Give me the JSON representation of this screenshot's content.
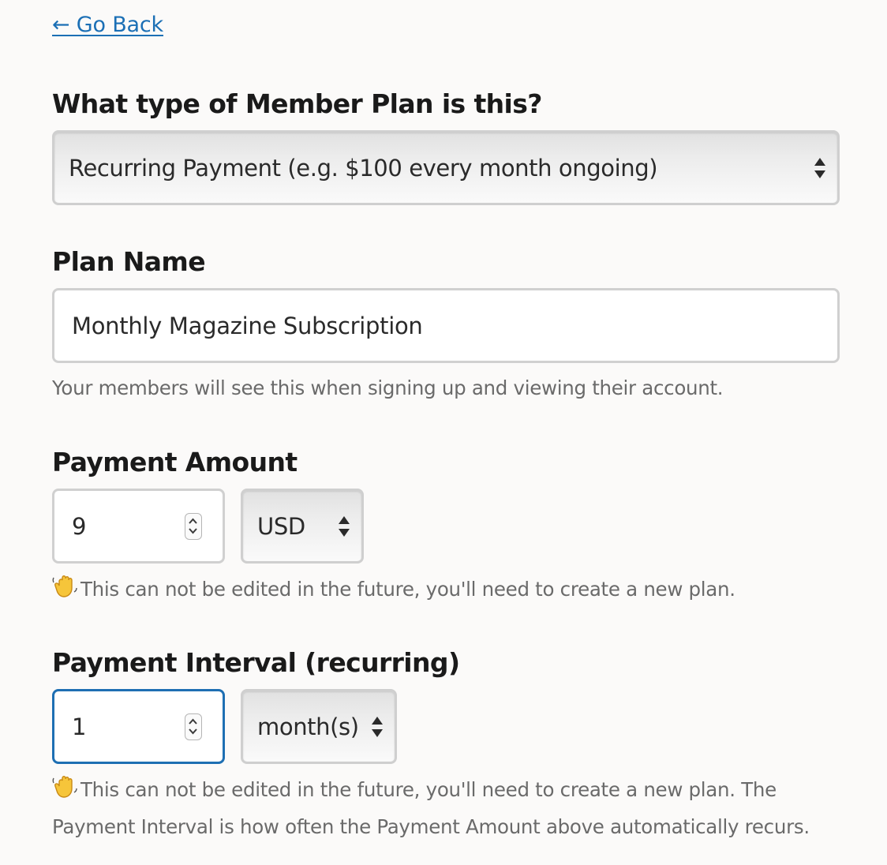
{
  "nav": {
    "back_label": "← Go Back"
  },
  "plan_type": {
    "label": "What type of Member Plan is this?",
    "selected": "Recurring Payment (e.g. $100 every month ongoing)"
  },
  "plan_name": {
    "label": "Plan Name",
    "value": "Monthly Magazine Subscription",
    "help": "Your members will see this when signing up and viewing their account."
  },
  "payment_amount": {
    "label": "Payment Amount",
    "value": "9",
    "currency": "USD",
    "note": "This can not be edited in the future, you'll need to create a new plan."
  },
  "payment_interval": {
    "label": "Payment Interval (recurring)",
    "value": "1",
    "unit": "month(s)",
    "note_line1": "This can not be edited in the future, you'll need to create a new plan. The",
    "note_line2": "Payment Interval is how often the Payment Amount above automatically recurs."
  },
  "icons": {
    "note": "waving-hand-icon",
    "select": "select-arrows-icon",
    "number": "number-spinner-icon"
  },
  "colors": {
    "link": "#1b6fb5",
    "focus_border": "#1e6fb3",
    "background": "#fbfaf9"
  }
}
